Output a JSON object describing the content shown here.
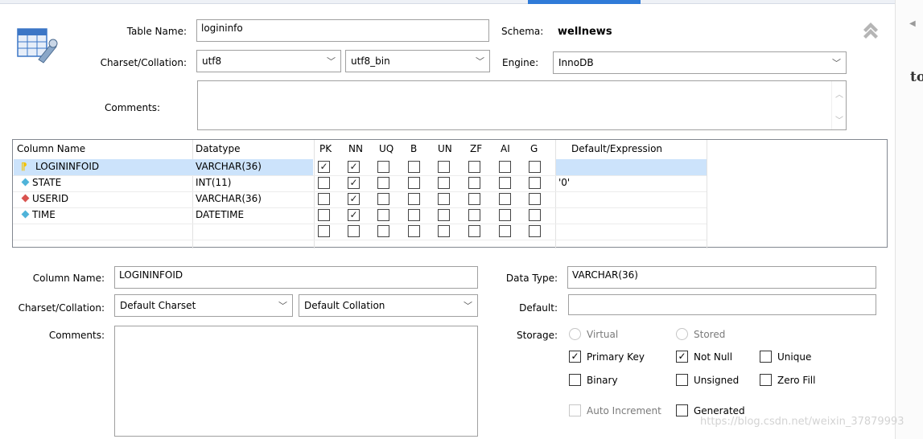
{
  "header": {
    "table_name_label": "Table Name:",
    "table_name_value": "logininfo",
    "schema_label": "Schema:",
    "schema_value": "wellnews",
    "charset_label": "Charset/Collation:",
    "charset_value": "utf8",
    "collation_value": "utf8_bin",
    "engine_label": "Engine:",
    "engine_value": "InnoDB",
    "comments_label": "Comments:",
    "comments_value": "",
    "collapse_icon": "double-chevron-up-icon"
  },
  "grid": {
    "headers": [
      "Column Name",
      "Datatype",
      "PK",
      "NN",
      "UQ",
      "B",
      "UN",
      "ZF",
      "AI",
      "G",
      "Default/Expression"
    ],
    "rows": [
      {
        "name": "LOGININFOID",
        "type": "VARCHAR(36)",
        "icon": "primary-key-icon",
        "flags": [
          true,
          true,
          false,
          false,
          false,
          false,
          false,
          false
        ],
        "default": "",
        "selected": true
      },
      {
        "name": "STATE",
        "type": "INT(11)",
        "icon": "column-diamond-icon",
        "flags": [
          false,
          true,
          false,
          false,
          false,
          false,
          false,
          false
        ],
        "default": "'0'"
      },
      {
        "name": "USERID",
        "type": "VARCHAR(36)",
        "icon": "foreign-key-diamond-icon",
        "flags": [
          false,
          true,
          false,
          false,
          false,
          false,
          false,
          false
        ],
        "default": ""
      },
      {
        "name": "TIME",
        "type": "DATETIME",
        "icon": "column-diamond-icon",
        "flags": [
          false,
          true,
          false,
          false,
          false,
          false,
          false,
          false
        ],
        "default": ""
      },
      {
        "name": "",
        "type": "",
        "icon": "",
        "flags": [
          false,
          false,
          false,
          false,
          false,
          false,
          false,
          false
        ],
        "default": ""
      }
    ],
    "colors": {
      "selected_row": "#cce3fb",
      "pk_icon": "#f2c200",
      "column_icon": "#4fb3d9",
      "fk_icon": "#d9534f"
    }
  },
  "detail": {
    "column_name_label": "Column Name:",
    "column_name_value": "LOGININFOID",
    "data_type_label": "Data Type:",
    "data_type_value": "VARCHAR(36)",
    "charset_label": "Charset/Collation:",
    "charset_value": "Default Charset",
    "collation_value": "Default Collation",
    "default_label": "Default:",
    "default_value": "",
    "comments_label": "Comments:",
    "comments_value": "",
    "storage_label": "Storage:",
    "virtual": "Virtual",
    "stored": "Stored",
    "primary_key": "Primary Key",
    "not_null": "Not Null",
    "unique": "Unique",
    "binary": "Binary",
    "unsigned": "Unsigned",
    "zero_fill": "Zero Fill",
    "auto_increment": "Auto Increment",
    "generated": "Generated"
  },
  "side": {
    "truncated_text": "to"
  },
  "watermark": "https://blog.csdn.net/weixin_37879993"
}
